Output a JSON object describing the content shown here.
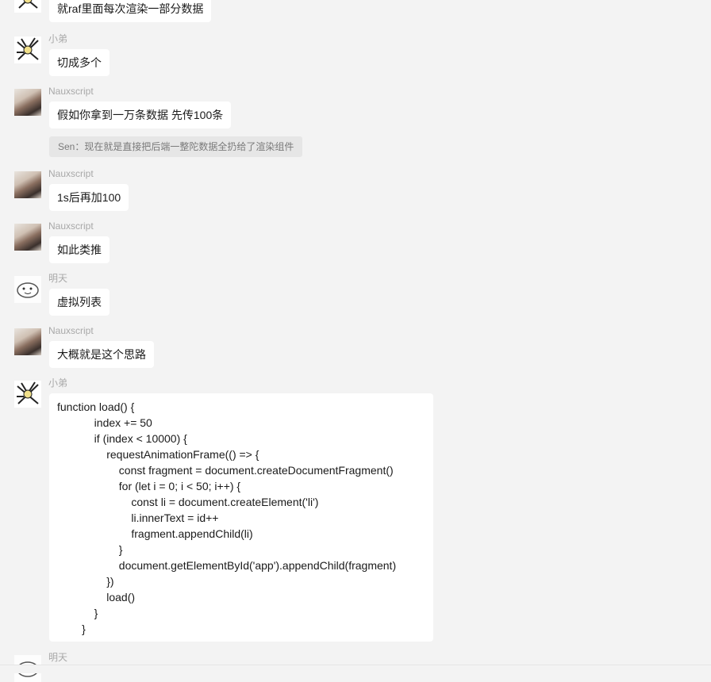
{
  "messages": [
    {
      "sender": "",
      "avatar": "xiaodi-avatar",
      "text": "就raf里面每次渲染一部分数据"
    },
    {
      "sender": "小弟",
      "avatar": "xiaodi-avatar",
      "text": "切成多个"
    },
    {
      "sender": "Nauxscript",
      "avatar": "nauxscript-avatar",
      "text": "假如你拿到一万条数据 先传100条",
      "quote": "Sen：现在就是直接把后端一整陀数据全扔给了渲染组件"
    },
    {
      "sender": "Nauxscript",
      "avatar": "nauxscript-avatar",
      "text": "1s后再加100"
    },
    {
      "sender": "Nauxscript",
      "avatar": "nauxscript-avatar",
      "text": "如此类推"
    },
    {
      "sender": "明天",
      "avatar": "mingtian-avatar",
      "text": "虚拟列表"
    },
    {
      "sender": "Nauxscript",
      "avatar": "nauxscript-avatar",
      "text": "大概就是这个思路"
    },
    {
      "sender": "小弟",
      "avatar": "xiaodi-avatar",
      "code": [
        "function load() {",
        "            index += 50",
        "            if (index < 10000) {",
        "                requestAnimationFrame(() => {",
        "                    const fragment = document.createDocumentFragment()",
        "                    for (let i = 0; i < 50; i++) {",
        "                        const li = document.createElement('li')",
        "                        li.innerText = id++",
        "                        fragment.appendChild(li)",
        "                    }",
        "                    document.getElementById('app').appendChild(fragment)",
        "                })",
        "                load()",
        "            }",
        "        }"
      ]
    },
    {
      "sender": "明天",
      "avatar": "mingtian-avatar",
      "text": ""
    }
  ]
}
